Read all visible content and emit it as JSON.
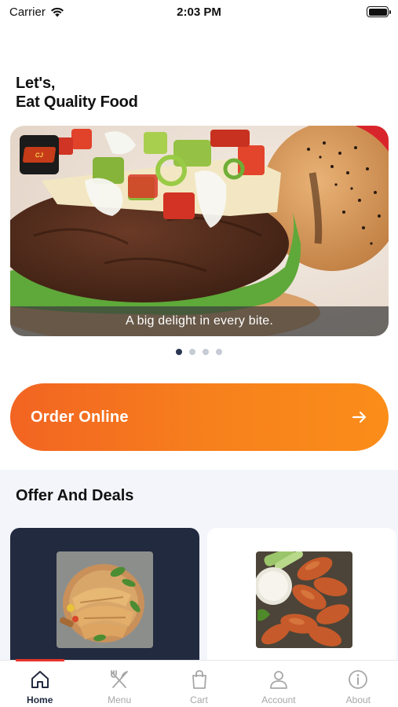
{
  "status_bar": {
    "carrier": "Carrier",
    "time": "2:03 PM"
  },
  "greeting": {
    "line1": "Let's,",
    "line2": "Eat Quality Food"
  },
  "banner": {
    "caption": "A big delight in every bite.",
    "slide_count": 4,
    "active_slide": 1
  },
  "order": {
    "label": "Order Online"
  },
  "offers": {
    "title": "Offer And Deals"
  },
  "tabs": [
    {
      "label": "Home",
      "icon": "home-icon"
    },
    {
      "label": "Menu",
      "icon": "fork-knife-icon"
    },
    {
      "label": "Cart",
      "icon": "shopping-bag-icon"
    },
    {
      "label": "Account",
      "icon": "user-icon"
    },
    {
      "label": "About",
      "icon": "info-icon"
    }
  ],
  "colors": {
    "accent": "#f26422",
    "dark": "#222a40",
    "indicator": "#e8352a"
  }
}
